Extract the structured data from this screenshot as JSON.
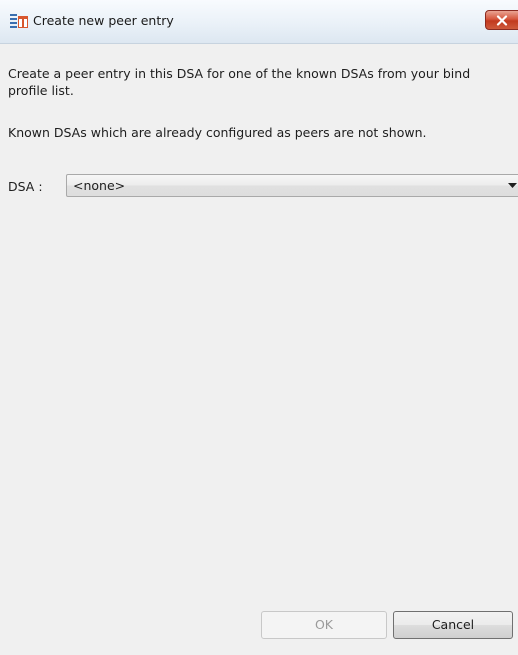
{
  "window": {
    "title": "Create new peer entry",
    "icon": "app-window-icon",
    "close_icon": "close-icon"
  },
  "content": {
    "description": "Create a peer entry in this DSA for one of the known DSAs from your bind profile list.",
    "note": "Known DSAs which are already configured as peers are not shown."
  },
  "dsa": {
    "label": "DSA :",
    "value": "<none>",
    "dropdown_icon": "chevron-down-icon"
  },
  "buttons": {
    "ok": "OK",
    "cancel": "Cancel"
  },
  "colors": {
    "close_button": "#c9452a",
    "dialog_background": "#f0f0f0",
    "disabled_text": "#9a9a9a"
  }
}
